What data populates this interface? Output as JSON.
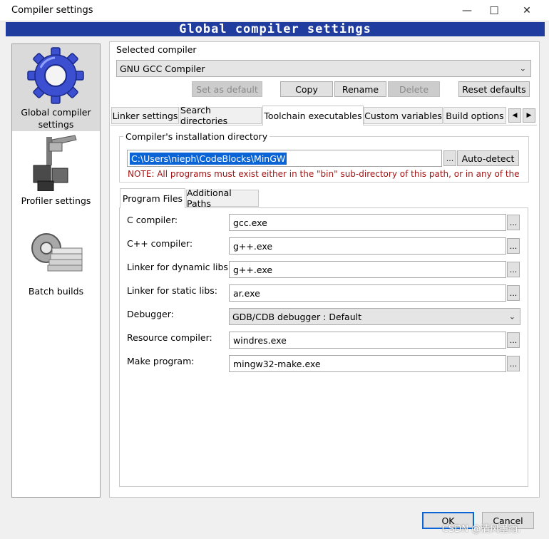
{
  "window": {
    "title": "Compiler settings",
    "minimize": "—",
    "maximize": "☐",
    "close": "✕"
  },
  "banner": "Global compiler settings",
  "sidebar": {
    "items": [
      {
        "label": "Global compiler settings",
        "icon": "gear-icon"
      },
      {
        "label": "Profiler settings",
        "icon": "profiler-icon"
      },
      {
        "label": "Batch builds",
        "icon": "batch-builds-icon"
      }
    ]
  },
  "compiler": {
    "label": "Selected compiler",
    "selected": "GNU GCC Compiler",
    "buttons": {
      "set_default": "Set as default",
      "copy": "Copy",
      "rename": "Rename",
      "delete": "Delete",
      "reset_defaults": "Reset defaults"
    }
  },
  "tabs": [
    "Linker settings",
    "Search directories",
    "Toolchain executables",
    "Custom variables",
    "Build options"
  ],
  "install_dir": {
    "label": "Compiler's installation directory",
    "value": "C:\\Users\\nieph\\CodeBlocks\\MinGW",
    "browse": "...",
    "auto_detect": "Auto-detect",
    "note": "NOTE: All programs must exist either in the \"bin\" sub-directory of this path, or in any of the"
  },
  "subtabs": [
    "Program Files",
    "Additional Paths"
  ],
  "programs": [
    {
      "label": "C compiler:",
      "value": "gcc.exe"
    },
    {
      "label": "C++ compiler:",
      "value": "g++.exe"
    },
    {
      "label": "Linker for dynamic libs:",
      "value": "g++.exe"
    },
    {
      "label": "Linker for static libs:",
      "value": "ar.exe"
    },
    {
      "label": "Debugger:",
      "value": "GDB/CDB debugger : Default"
    },
    {
      "label": "Resource compiler:",
      "value": "windres.exe"
    },
    {
      "label": "Make program:",
      "value": "mingw32-make.exe"
    }
  ],
  "footer": {
    "ok": "OK",
    "cancel": "Cancel"
  },
  "watermark": "CSDN @清风墨雨."
}
